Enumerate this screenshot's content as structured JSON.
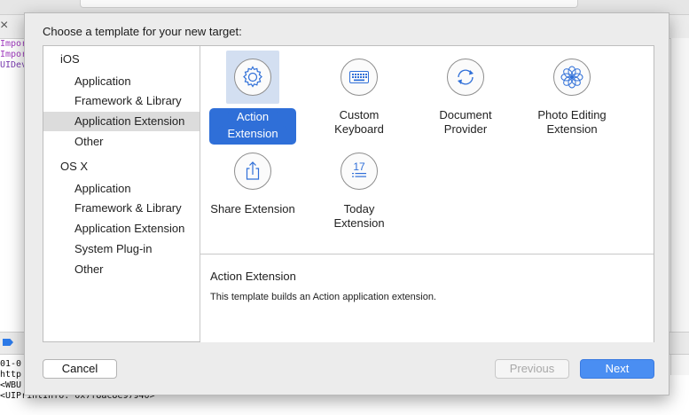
{
  "background": {
    "code_lines": [
      "Impor",
      "Impor",
      "",
      "UIDev"
    ],
    "console_lines": [
      "01-0",
      "http",
      "<WBU",
      "<UIPrintInfo: 0x7f8ac8e97940>\""
    ]
  },
  "dialog": {
    "title": "Choose a template for your new target:",
    "sidebar": {
      "groups": [
        {
          "label": "iOS",
          "items": [
            "Application",
            "Framework & Library",
            "Application Extension",
            "Other"
          ]
        },
        {
          "label": "OS X",
          "items": [
            "Application",
            "Framework & Library",
            "Application Extension",
            "System Plug-in",
            "Other"
          ]
        }
      ],
      "selected": "iOS / Application Extension"
    },
    "templates": [
      {
        "label_lines": [
          "Action",
          "Extension"
        ],
        "icon": "gear-icon",
        "selected": true
      },
      {
        "label_lines": [
          "Custom",
          "Keyboard"
        ],
        "icon": "keyboard-icon",
        "selected": false
      },
      {
        "label_lines": [
          "Document",
          "Provider"
        ],
        "icon": "refresh-icon",
        "selected": false
      },
      {
        "label_lines": [
          "Photo Editing",
          "Extension"
        ],
        "icon": "flower-icon",
        "selected": false
      },
      {
        "label_lines": [
          "Share Extension"
        ],
        "icon": "share-icon",
        "selected": false
      },
      {
        "label_lines": [
          "Today",
          "Extension"
        ],
        "icon": "calendar-17-icon",
        "icon_text": "17",
        "selected": false
      }
    ],
    "description": {
      "title": "Action Extension",
      "text": "This template builds an Action application extension."
    },
    "buttons": {
      "cancel": "Cancel",
      "previous": "Previous",
      "next": "Next"
    }
  },
  "colors": {
    "accent": "#2f6fd8",
    "next_button": "#4a8ef2",
    "selection_bg": "#dcdcdc",
    "icon_line": "#2f6fd8"
  }
}
